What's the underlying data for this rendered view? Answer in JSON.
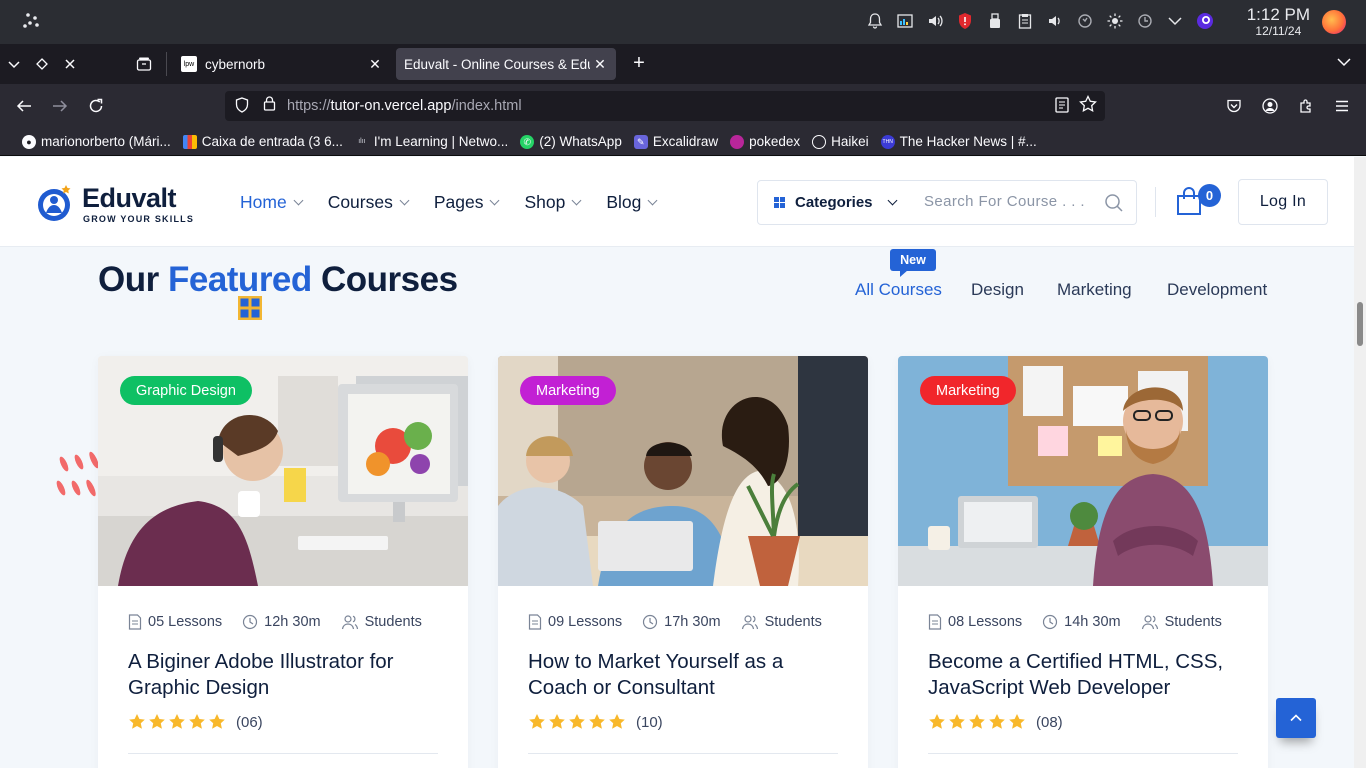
{
  "system": {
    "time": "1:12 PM",
    "date": "12/11/24"
  },
  "browser": {
    "tabs": [
      {
        "title": "cybernorb",
        "favicon_text": "lpw"
      },
      {
        "title": "Eduvalt - Online Courses & Education"
      }
    ],
    "url_prefix": "https://",
    "url_main": "tutor-on.vercel.app",
    "url_path": "/index.html",
    "bookmarks": [
      {
        "label": "marionorberto (Mári...",
        "icon": "github-icon"
      },
      {
        "label": "Caixa de entrada (3 6...",
        "icon": "gmail-icon"
      },
      {
        "label": "I'm Learning | Netwo...",
        "icon": "cisco-icon"
      },
      {
        "label": "(2) WhatsApp",
        "icon": "whatsapp-icon"
      },
      {
        "label": "Excalidraw",
        "icon": "excalidraw-icon"
      },
      {
        "label": "pokedex",
        "icon": "pokedex-icon"
      },
      {
        "label": "Haikei",
        "icon": "globe-icon"
      },
      {
        "label": "The Hacker News | #...",
        "icon": "thn-icon"
      }
    ]
  },
  "site": {
    "logo_name": "Eduvalt",
    "logo_tagline": "GROW YOUR SKILLS",
    "nav": [
      "Home",
      "Courses",
      "Pages",
      "Shop",
      "Blog"
    ],
    "categories_label": "Categories",
    "search_placeholder": "Search For Course . . .",
    "cart_count": "0",
    "login_label": "Log In",
    "accent_color": "#2463d6"
  },
  "featured": {
    "title_before": "Our",
    "title_accent": "Featured",
    "title_after": "Courses",
    "new_badge": "New",
    "filters": [
      "All Courses",
      "Design",
      "Marketing",
      "Development"
    ]
  },
  "courses": [
    {
      "badge": "Graphic Design",
      "badge_color": "#0ec064",
      "lessons": "05 Lessons",
      "duration": "12h 30m",
      "students": "Students",
      "title": "A Biginer Adobe Illustrator for Graphic Design",
      "rating": 5,
      "rating_count": "(06)"
    },
    {
      "badge": "Marketing",
      "badge_color": "#c220d4",
      "lessons": "09 Lessons",
      "duration": "17h 30m",
      "students": "Students",
      "title": "How to Market Yourself as a Coach or Consultant",
      "rating": 5,
      "rating_count": "(10)"
    },
    {
      "badge": "Marketing",
      "badge_color": "#f1262b",
      "lessons": "08 Lessons",
      "duration": "14h 30m",
      "students": "Students",
      "title": "Become a Certified HTML, CSS, JavaScript Web Developer",
      "rating": 5,
      "rating_count": "(08)"
    }
  ]
}
